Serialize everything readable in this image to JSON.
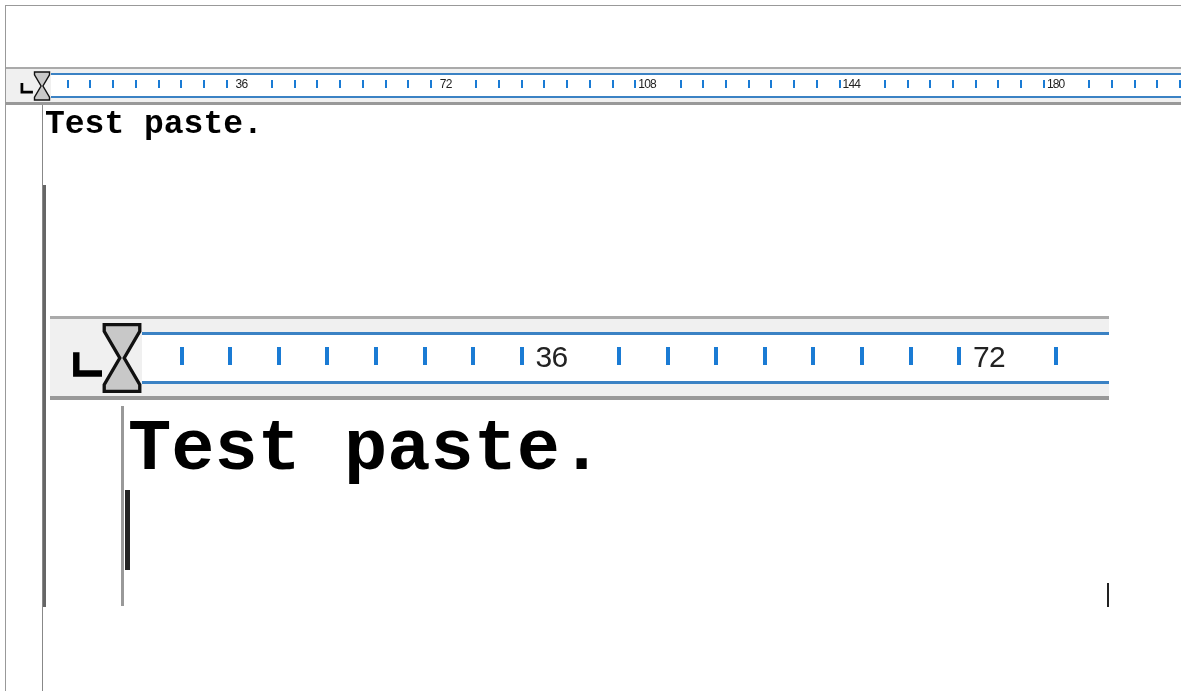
{
  "ruler": {
    "labels": [
      "36",
      "72",
      "108",
      "144",
      "180"
    ]
  },
  "document": {
    "text": "Test paste."
  },
  "pasted_screenshot": {
    "ruler": {
      "labels": [
        "36",
        "72"
      ]
    },
    "text": "Test paste."
  }
}
